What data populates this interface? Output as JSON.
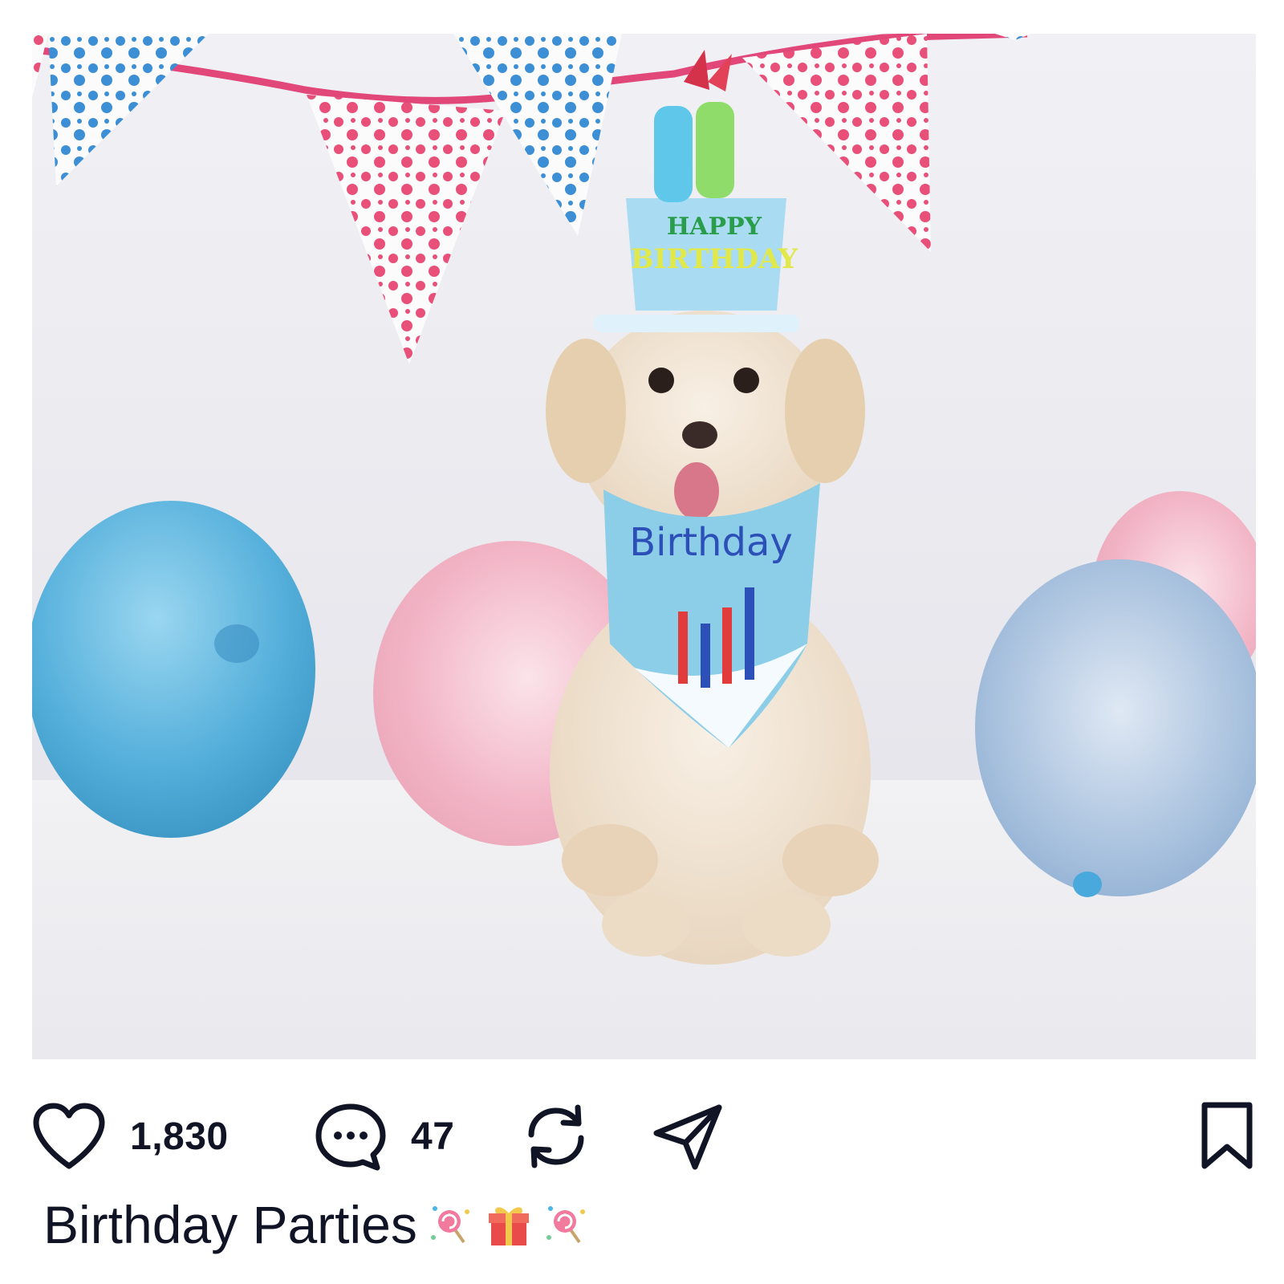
{
  "post": {
    "image": {
      "alt_semantic": "photo",
      "hat_text_line1": "HAPPY",
      "hat_text_line2": "BIRTHDAY",
      "bandana_text": "Birthday"
    },
    "actions": {
      "likes": "1,830",
      "comments": "47"
    },
    "caption": {
      "text": "Birthday Parties",
      "emojis": [
        "lollipop-icon",
        "gift-icon",
        "lollipop-icon"
      ]
    }
  },
  "colors": {
    "ink": "#111425",
    "wall": "#ececf1",
    "balloon_blue": "#5fb6dc",
    "balloon_pink": "#f3b9c9",
    "bunting_pink": "#e8507a",
    "bunting_blue": "#3c8fd4"
  }
}
